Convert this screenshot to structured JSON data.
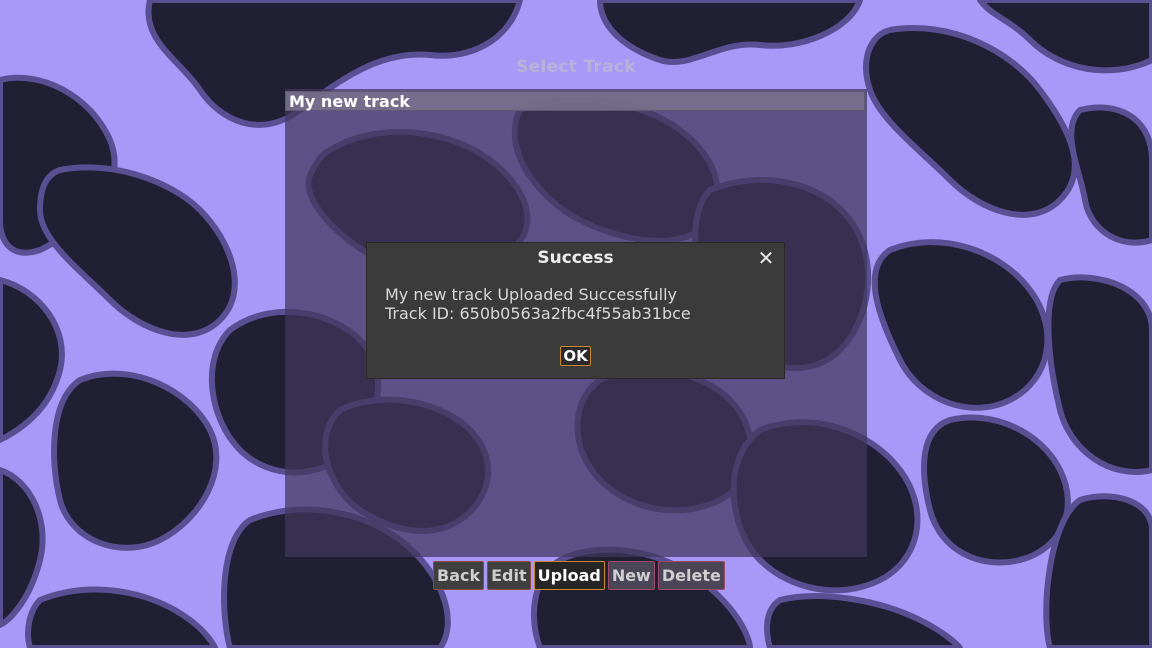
{
  "screen": {
    "title": "Select Track",
    "colors": {
      "background_light": "#a898f8",
      "background_dark": "#211f33",
      "accent": "#c98a2a"
    }
  },
  "track_list": {
    "items": [
      {
        "name": "My new track",
        "selected": true
      }
    ]
  },
  "dialog": {
    "title": "Success",
    "close_icon": "close-icon",
    "message_line1": "My new track Uploaded Successfully",
    "message_line2": "Track ID: 650b0563a2fbc4f55ab31bce",
    "ok_label": "OK"
  },
  "actions": {
    "back_label": "Back",
    "edit_label": "Edit",
    "upload_label": "Upload",
    "new_label": "New",
    "delete_label": "Delete"
  }
}
